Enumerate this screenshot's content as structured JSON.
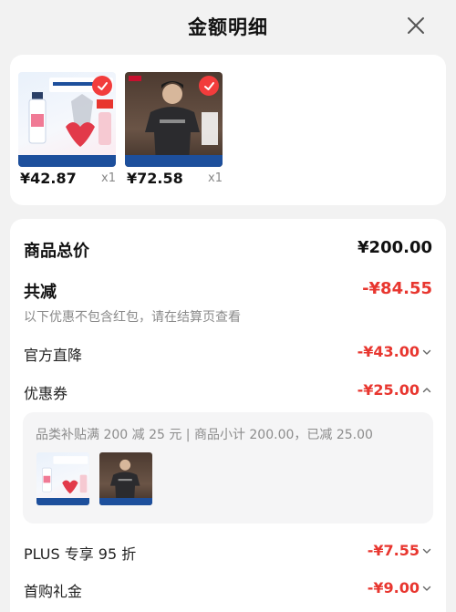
{
  "header": {
    "title": "金额明细"
  },
  "products": [
    {
      "price": "¥42.87",
      "qty": "x1",
      "selected": true,
      "image": "cleansing-water-product-photo"
    },
    {
      "price": "¥72.58",
      "qty": "x1",
      "selected": true,
      "image": "tshirt-model-product-photo"
    }
  ],
  "summary": {
    "total_label": "商品总价",
    "total_value": "¥200.00",
    "reduce_label": "共减",
    "reduce_value": "-¥84.55",
    "note": "以下优惠不包含红包，请在结算页查看"
  },
  "discounts": {
    "official": {
      "label": "官方直降",
      "value": "-¥43.00",
      "state": "collapsed"
    },
    "coupon": {
      "label": "优惠券",
      "value": "-¥25.00",
      "state": "expanded",
      "detail": "品类补贴满 200 减 25 元 | 商品小计 200.00，已减 25.00"
    },
    "plus": {
      "label": "PLUS 专享 95 折",
      "value": "-¥7.55",
      "state": "collapsed"
    },
    "first": {
      "label": "首购礼金",
      "value": "-¥9.00",
      "state": "collapsed"
    }
  },
  "colors": {
    "accent": "#e8362f",
    "check": "#f23c3c"
  }
}
